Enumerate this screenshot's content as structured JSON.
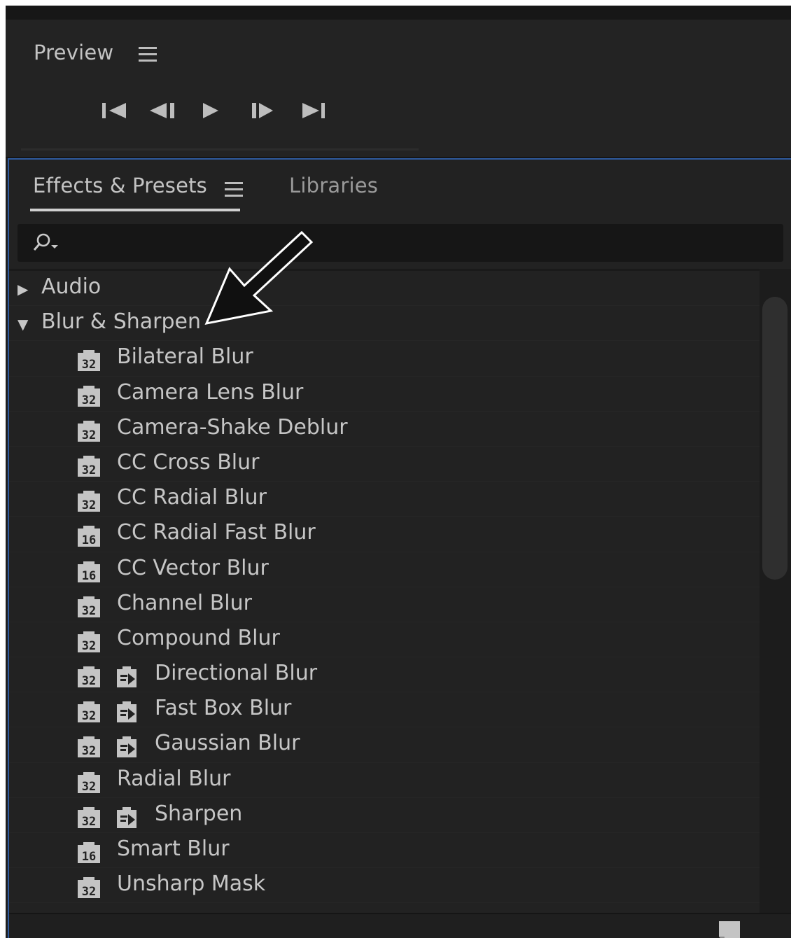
{
  "preview": {
    "title": "Preview",
    "transport_controls": [
      "first-frame-icon",
      "previous-frame-icon",
      "play-icon",
      "next-frame-icon",
      "last-frame-icon"
    ]
  },
  "effects_panel": {
    "tabs": [
      {
        "label": "Effects & Presets",
        "active": true
      },
      {
        "label": "Libraries",
        "active": false
      }
    ],
    "search": {
      "placeholder": "",
      "value": ""
    }
  },
  "tree": [
    {
      "label": "Audio",
      "type": "category",
      "expanded": false
    },
    {
      "label": "Blur & Sharpen",
      "type": "category",
      "expanded": true
    },
    {
      "label": "Bilateral Blur",
      "badges": [
        "32"
      ]
    },
    {
      "label": "Camera Lens Blur",
      "badges": [
        "32"
      ]
    },
    {
      "label": "Camera-Shake Deblur",
      "badges": [
        "32"
      ]
    },
    {
      "label": "CC Cross Blur",
      "badges": [
        "32"
      ]
    },
    {
      "label": "CC Radial Blur",
      "badges": [
        "32"
      ]
    },
    {
      "label": "CC Radial Fast Blur",
      "badges": [
        "16"
      ]
    },
    {
      "label": "CC Vector Blur",
      "badges": [
        "16"
      ]
    },
    {
      "label": "Channel Blur",
      "badges": [
        "32"
      ]
    },
    {
      "label": "Compound Blur",
      "badges": [
        "32"
      ]
    },
    {
      "label": "Directional Blur",
      "badges": [
        "32",
        "gpu"
      ]
    },
    {
      "label": "Fast Box Blur",
      "badges": [
        "32",
        "gpu"
      ]
    },
    {
      "label": "Gaussian Blur",
      "badges": [
        "32",
        "gpu"
      ]
    },
    {
      "label": "Radial Blur",
      "badges": [
        "32"
      ]
    },
    {
      "label": "Sharpen",
      "badges": [
        "32",
        "gpu"
      ]
    },
    {
      "label": "Smart Blur",
      "badges": [
        "16"
      ]
    },
    {
      "label": "Unsharp Mask",
      "badges": [
        "32"
      ]
    }
  ],
  "colors": {
    "panel_bg": "#222222",
    "focus_border": "#2e5a9e",
    "text": "#c6c6c6"
  }
}
